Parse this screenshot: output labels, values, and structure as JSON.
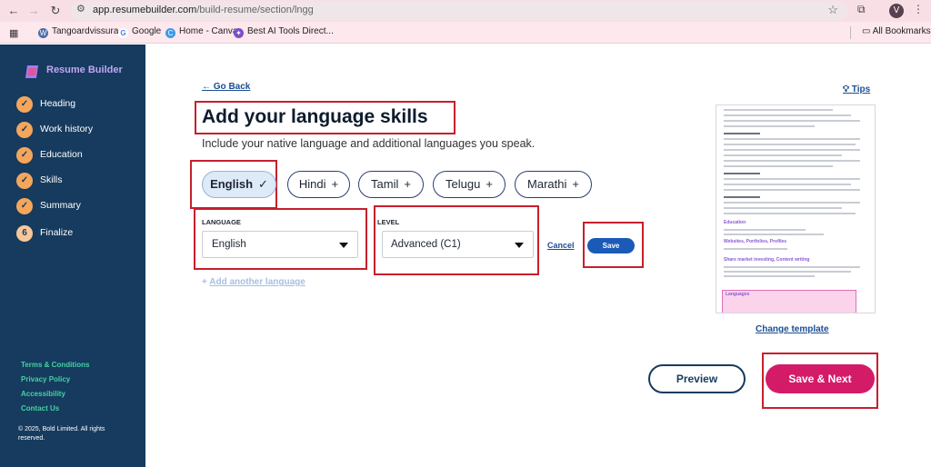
{
  "browser": {
    "url_prefix": "app.resumebuilder.com",
    "url_rest": "/build-resume/section/lngg",
    "avatar_letter": "V",
    "bookmarks": [
      "Tangoardvissura -",
      "Google",
      "Home - Canva",
      "Best AI Tools Direct..."
    ],
    "all_bookmarks": "All Bookmarks"
  },
  "sidebar": {
    "brand": "Resume Builder",
    "steps": [
      {
        "label": "Heading",
        "marker": "✓"
      },
      {
        "label": "Work history",
        "marker": "✓"
      },
      {
        "label": "Education",
        "marker": "✓"
      },
      {
        "label": "Skills",
        "marker": "✓"
      },
      {
        "label": "Summary",
        "marker": "✓"
      },
      {
        "label": "Finalize",
        "marker": "6"
      }
    ],
    "footer_links": [
      "Terms & Conditions",
      "Privacy Policy",
      "Accessibility",
      "Contact Us"
    ],
    "copyright": "© 2025, Bold Limited. All rights reserved."
  },
  "main": {
    "go_back": "Go Back",
    "tips": "Tips",
    "title": "Add your language skills",
    "subtitle": "Include your native language and additional languages you speak.",
    "chips": [
      {
        "label": "English",
        "symbol": "✓",
        "selected": true
      },
      {
        "label": "Hindi",
        "symbol": "+",
        "selected": false
      },
      {
        "label": "Tamil",
        "symbol": "+",
        "selected": false
      },
      {
        "label": "Telugu",
        "symbol": "+",
        "selected": false
      },
      {
        "label": "Marathi",
        "symbol": "+",
        "selected": false
      }
    ],
    "language_label": "LANGUAGE",
    "language_value": "English",
    "level_label": "LEVEL",
    "level_value": "Advanced (C1)",
    "cancel": "Cancel",
    "save": "Save",
    "add_another": "Add another language",
    "change_template": "Change template",
    "preview": "Preview",
    "save_next": "Save & Next"
  },
  "resume_preview": {
    "sections": [
      "Education",
      "Websites, Portfolios, Profiles",
      "Share market investing, Content writing",
      "Languages"
    ]
  },
  "colors": {
    "sidebar_bg": "#163b5e",
    "accent_pink": "#d41b68",
    "accent_blue": "#1c5ab8",
    "step_orange": "#f5a65b",
    "footer_green": "#43d2a4",
    "highlight_red": "#c71f2c"
  }
}
